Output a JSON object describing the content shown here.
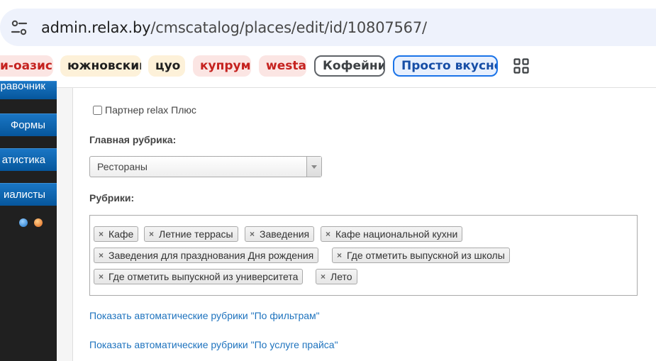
{
  "browser": {
    "url_host": "admin.relax.by",
    "url_path": "/cmscatalog/places/edit/id/10807567/"
  },
  "bookmarks": [
    {
      "label": "и-оазис"
    },
    {
      "label": "южновский"
    },
    {
      "label": "цуо"
    },
    {
      "label": "купрум"
    },
    {
      "label": "westa"
    },
    {
      "label": "Кофейни"
    },
    {
      "label": "Просто вкусно"
    }
  ],
  "sidebar": {
    "items": [
      {
        "label": "равочник"
      },
      {
        "label": "Формы"
      },
      {
        "label": "атистика"
      },
      {
        "label": "иалисты"
      }
    ]
  },
  "form": {
    "partner_label": "Партнер relax Плюс",
    "partner_checked": false,
    "main_rubric_label": "Главная рубрика:",
    "main_rubric_value": "Рестораны",
    "rubrics_label": "Рубрики:",
    "rubrics": [
      "Кафе",
      "Летние террасы",
      "Заведения",
      "Кафе национальной кухни",
      "Заведения для празднования Дня рождения",
      "Где отметить выпускной из школы",
      "Где отметить выпускной из университета",
      "Лето"
    ],
    "link_filters": "Показать автоматические рубрики \"По фильтрам\"",
    "link_price": "Показать автоматические рубрики \"По услуге прайса\""
  }
}
